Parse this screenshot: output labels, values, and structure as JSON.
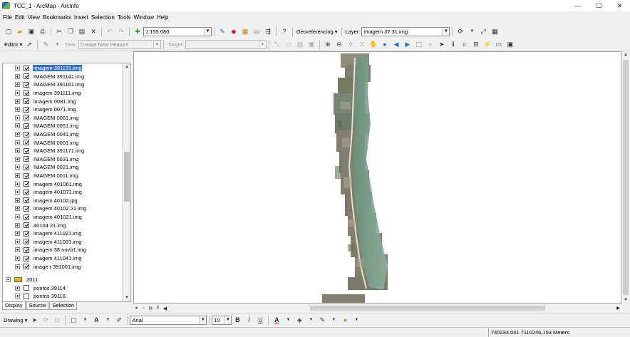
{
  "window": {
    "title": "TCC_1 - ArcMap - ArcInfo",
    "minimize": "—",
    "maximize": "☐",
    "close": "✕"
  },
  "menu": [
    "File",
    "Edit",
    "View",
    "Bookmarks",
    "Insert",
    "Selection",
    "Tools",
    "Window",
    "Help"
  ],
  "toolbar_standard": {
    "scale": "1:155.080",
    "georeferencing_label": "Georeferencing ▾",
    "layer_label": "Layer:",
    "layer_value": "imagem 37 31.img"
  },
  "toolbar_editor": {
    "editor_label": "Editor ▾",
    "task_label": "Task:",
    "task_value": "Create New Feature",
    "target_label": "Target:",
    "target_value": ""
  },
  "toc": {
    "layers": [
      {
        "name": "imagem 391131.img",
        "checked": true,
        "selected": true
      },
      {
        "name": "IMAGEM 391141.img",
        "checked": true
      },
      {
        "name": "IMAGEM 391161.img",
        "checked": true
      },
      {
        "name": "imagem 391111.img",
        "checked": true
      },
      {
        "name": "imagem 0081.img",
        "checked": true
      },
      {
        "name": "imagem 0071.img",
        "checked": true
      },
      {
        "name": "IMAGEM 0061.img",
        "checked": true
      },
      {
        "name": "IMAGEM 0051.img",
        "checked": true
      },
      {
        "name": "IMAGEM 0041.img",
        "checked": true
      },
      {
        "name": "IMAGEM 0001.img",
        "checked": true
      },
      {
        "name": "IMAGEM 391171.img",
        "checked": true
      },
      {
        "name": "IMAGEM 0031.img",
        "checked": true
      },
      {
        "name": "IMAGEM 0021.img",
        "checked": true
      },
      {
        "name": "IMAGEM 0011.img",
        "checked": true
      },
      {
        "name": "imagem 401061.img",
        "checked": true
      },
      {
        "name": "imagem 401071.img",
        "checked": true
      },
      {
        "name": "imagem 40102.jpg",
        "checked": true
      },
      {
        "name": "imagem 40102 21.img",
        "checked": true
      },
      {
        "name": "imagem 401021.img",
        "checked": true
      },
      {
        "name": "40104 21.img",
        "checked": true
      },
      {
        "name": "imagem 411021.img",
        "checked": true
      },
      {
        "name": "imagem 411031.img",
        "checked": true
      },
      {
        "name": "imagem 38 novo1.img",
        "checked": true
      },
      {
        "name": "imagem 411041.img",
        "checked": true
      },
      {
        "name": "image r 391001.img",
        "checked": true
      }
    ],
    "group": {
      "name": "2011"
    },
    "group_layers": [
      {
        "name": "pontos 39114",
        "checked": false
      },
      {
        "name": "pontos 39116",
        "checked": false
      }
    ],
    "tabs": [
      "Display",
      "Source",
      "Selection"
    ]
  },
  "drawing": {
    "drawing_label": "Drawing ▾",
    "font": "Arial",
    "size": "10",
    "bold": "B",
    "italic": "I",
    "underline": "U"
  },
  "status": {
    "coordinates": "740234,041  7110246,153 Meters"
  },
  "colors": {
    "selection": "#3373d0",
    "font_color": "#c00000",
    "fill_color": "#4fbf3a"
  }
}
